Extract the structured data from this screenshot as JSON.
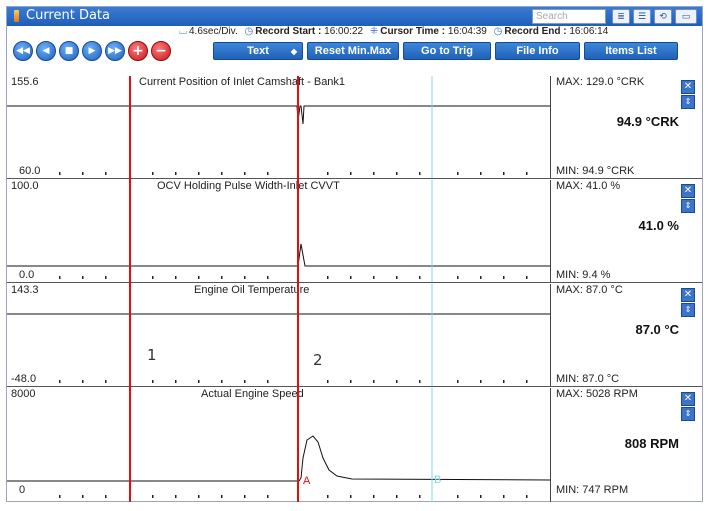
{
  "window": {
    "title": "Current Data"
  },
  "search": {
    "placeholder": "Search"
  },
  "info": {
    "time_div": "4.6sec/Div.",
    "record_start_label": "Record Start :",
    "record_start": "16:00:22",
    "cursor_time_label": "Cursor Time :",
    "cursor_time": "16:04:39",
    "record_end_label": "Record End :",
    "record_end": "16:06:14"
  },
  "toolbar": {
    "text_select": "Text",
    "reset_minmax": "Reset Min.Max",
    "go_to_trig": "Go to Trig",
    "file_info": "File Info",
    "items_list": "Items List"
  },
  "markers": {
    "m1": "1",
    "m2": "2",
    "cursor_a": "A",
    "cursor_b": "B"
  },
  "colors": {
    "titlebar": "#2a6ccc",
    "marker_line": "#e01010",
    "cursor_line": "#7fd8e0",
    "button_blue": "#2b6fc6"
  },
  "icons": [
    "rewind-icon",
    "step-back-icon",
    "stop-icon",
    "step-forward-icon",
    "fast-forward-icon",
    "zoom-in-icon",
    "zoom-out-icon",
    "search-option-icon",
    "list-icon",
    "retry-icon",
    "window-icon",
    "close-icon",
    "updown-icon"
  ],
  "panels": [
    {
      "title": "Current Position of Inlet Camshaft - Bank1",
      "scale_max": "155.6",
      "scale_min": "60.0",
      "max": "MAX:  129.0 °CRK",
      "min": "MIN:  94.9 °CRK",
      "current": "94.9 °CRK"
    },
    {
      "title": "OCV Holding Pulse Width-Inlet CVVT",
      "scale_max": "100.0",
      "scale_min": "0.0",
      "max": "MAX:  41.0 %",
      "min": "MIN:   9.4 %",
      "current": "41.0 %"
    },
    {
      "title": "Engine Oil Temperature",
      "scale_max": "143.3",
      "scale_min": "-48.0",
      "max": "MAX:  87.0 °C",
      "min": "MIN:  87.0 °C",
      "current": "87.0 °C"
    },
    {
      "title": "Actual Engine Speed",
      "scale_max": "8000",
      "scale_min": "0",
      "max": "MAX:   5028 RPM",
      "min": "MIN:    747 RPM",
      "current": "808 RPM"
    }
  ]
}
